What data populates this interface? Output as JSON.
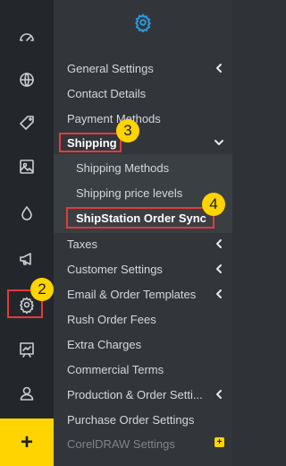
{
  "rail": {
    "items": [
      {
        "icon": "dashboard-gauge-icon"
      },
      {
        "icon": "globe-icon"
      },
      {
        "icon": "tag-icon"
      },
      {
        "icon": "image-icon"
      },
      {
        "icon": "drop-icon"
      },
      {
        "icon": "megaphone-icon"
      },
      {
        "icon": "gear-icon"
      },
      {
        "icon": "chart-board-icon"
      },
      {
        "icon": "user-icon"
      }
    ],
    "add_label": "+"
  },
  "panel": {
    "header_icon": "gear-icon",
    "items": [
      {
        "label": "General Settings",
        "arrow": "left"
      },
      {
        "label": "Contact Details"
      },
      {
        "label": "Payment Methods"
      },
      {
        "label": "Shipping",
        "arrow": "down"
      },
      {
        "label": "Shipping Methods"
      },
      {
        "label": "Shipping price levels"
      },
      {
        "label": "ShipStation Order Sync"
      },
      {
        "label": "Taxes",
        "arrow": "left"
      },
      {
        "label": "Customer Settings",
        "arrow": "left"
      },
      {
        "label": "Email & Order Templates",
        "arrow": "left"
      },
      {
        "label": "Rush Order Fees"
      },
      {
        "label": "Extra Charges"
      },
      {
        "label": "Commercial Terms"
      },
      {
        "label": "Production & Order Setti...",
        "arrow": "left"
      },
      {
        "label": "Purchase Order Settings"
      },
      {
        "label": "CorelDRAW Settings"
      }
    ]
  },
  "annotations": {
    "badge_2": "2",
    "badge_3": "3",
    "badge_4": "4",
    "highlight_color": "#e53a3a",
    "badge_color": "#ffd400"
  },
  "colors": {
    "rail_bg": "#23272b",
    "panel_bg": "#32363b",
    "accent_blue": "#2b9be0",
    "add_button_yellow": "#ffd400"
  }
}
